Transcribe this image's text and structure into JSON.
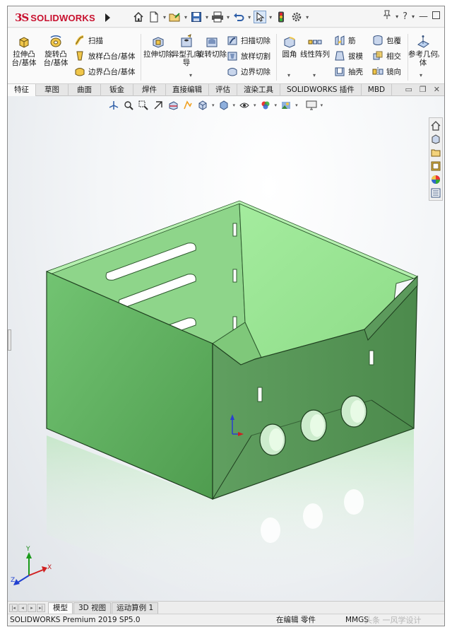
{
  "app": {
    "logo_mark": "3S",
    "logo_text": "SOLIDWORKS"
  },
  "quick_access": {
    "icons": [
      "home-icon",
      "new-document-icon",
      "open-icon",
      "save-icon",
      "print-icon",
      "undo-icon",
      "select-cursor-icon",
      "traffic-light-icon",
      "options-gear-icon",
      "pin-icon",
      "help-icon",
      "user-icon",
      "restore-icon"
    ]
  },
  "ribbon": {
    "extrude_boss": "拉伸凸台/基体",
    "revolve_boss": "旋转凸台/基体",
    "sweep": "扫描",
    "loft_boss": "放样凸台/基体",
    "boundary_boss": "边界凸台/基体",
    "extrude_cut": "拉伸切除",
    "hole_wizard": "异型孔向导",
    "revolve_cut": "旋转切除",
    "swept_cut": "扫描切除",
    "lofted_cut": "放样切割",
    "boundary_cut": "边界切除",
    "fillet": "圆角",
    "linear_pattern": "线性阵列",
    "rib": "筋",
    "draft": "拔模",
    "shell": "抽壳",
    "wrap": "包覆",
    "intersect": "相交",
    "mirror": "镜向",
    "ref_geometry": "参考几何体"
  },
  "tabs": [
    {
      "label": "特征",
      "active": true
    },
    {
      "label": "草图"
    },
    {
      "label": "曲面"
    },
    {
      "label": "钣金"
    },
    {
      "label": "焊件"
    },
    {
      "label": "直接编辑"
    },
    {
      "label": "评估"
    },
    {
      "label": "渲染工具"
    },
    {
      "label": "SOLIDWORKS 插件"
    },
    {
      "label": "MBD"
    }
  ],
  "heads_up_toolbar": [
    "view-orientation-icon",
    "zoom-to-fit-icon",
    "zoom-area-icon",
    "previous-view-icon",
    "section-view-icon",
    "dynamic-annotation-icon",
    "view-orientation-cube-icon",
    "display-style-icon",
    "hide-show-icon",
    "edit-appearance-icon",
    "apply-scene-icon",
    "view-settings-icon"
  ],
  "task_pane": [
    "solidworks-resources-icon",
    "design-library-icon",
    "file-explorer-icon",
    "view-palette-icon",
    "appearances-icon",
    "custom-properties-icon"
  ],
  "model_tabs": [
    {
      "label": "模型",
      "active": true
    },
    {
      "label": "3D 视图"
    },
    {
      "label": "运动算例 1"
    }
  ],
  "status": {
    "version": "SOLIDWORKS Premium 2019 SP5.0",
    "mode": "在编辑 零件",
    "units": "MMGS"
  },
  "watermark": "头条 一风学设计",
  "triad": {
    "x": "X",
    "y": "Y",
    "z": "Z"
  },
  "colors": {
    "model_fill": "#8fdc8f",
    "model_shadow": "#5fa85f",
    "accent_red": "#c8102e"
  }
}
